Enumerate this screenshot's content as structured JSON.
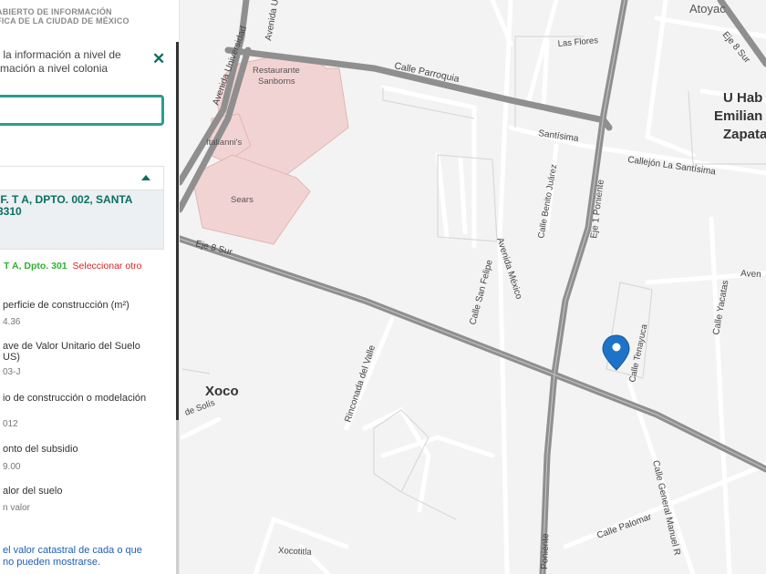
{
  "header": {
    "title_line1": "ABIERTO DE INFORMACIÓN",
    "title_line2": "FICA DE LA CIUDAD DE MÉXICO"
  },
  "panel": {
    "intro_text": "r la información a nivel de rmación a nivel colonia",
    "search_value": "",
    "result_address": "IF. T A, DPTO. 002, SANTA 3310",
    "sub_department": "T A, Dpto. 301",
    "sub_select_label": "Seleccionar otro",
    "fields": [
      {
        "label": "perficie de construcción (m²)",
        "value": "4.36"
      },
      {
        "label": "ave de Valor Unitario del Suelo US)",
        "value": "03-J"
      },
      {
        "label": "io de construcción o modelación",
        "value": "012"
      },
      {
        "label": "onto del subsidio",
        "value": "9.00"
      },
      {
        "label": "alor del suelo",
        "value": "n valor"
      }
    ],
    "footer_note": "el valor catastral de cada o que no pueden mostrarse."
  },
  "map": {
    "places": {
      "atoyac": "Atoyac",
      "u_hab_1": "U Hab",
      "u_hab_2": "Emilian",
      "u_hab_3": "Zapata",
      "xoco": "Xoco"
    },
    "pois": {
      "restaurante": "Restaurante",
      "sanborns": "Sanborns",
      "italiannis": "Italianni's",
      "sears": "Sears"
    },
    "streets": {
      "av_universidad": "Avenida Universidad",
      "calle_parroquia": "Calle Parroquia",
      "las_flores": "Las Flores",
      "av_universidad_top": "Avenida Universidad",
      "eje_sur_top": "Eje 8 Sur",
      "santisima": "Santísima",
      "callejon_santisima": "Callejón La Santísima",
      "calle_benito_juarez": "Calle Benito Juárez",
      "eje1_poniente": "Eje 1 Poniente",
      "eje1_poniente_bottom": "Poniente",
      "eje8_sur": "Eje 8 Sur",
      "calle_san_felipe": "Calle San Felipe",
      "avenida_mexico": "Avenida México",
      "avenida_right": "Aven",
      "calle_yacatas": "Calle Yacatas",
      "calle_tenayuca": "Calle Tenayuca",
      "rinconada_del_valle": "Rinconada del Valle",
      "de_solis": "de Solís",
      "calle_general_manuel": "Calle General Manuel R",
      "calle_palomar": "Calle Palomar",
      "xocotitla": "Xocotitla"
    }
  },
  "colors": {
    "accent": "#0b6e62",
    "search_border": "#2b9d8f",
    "marker": "#1e73c8",
    "building": "#f2d3d3",
    "major_road": "#8f8f8f"
  }
}
